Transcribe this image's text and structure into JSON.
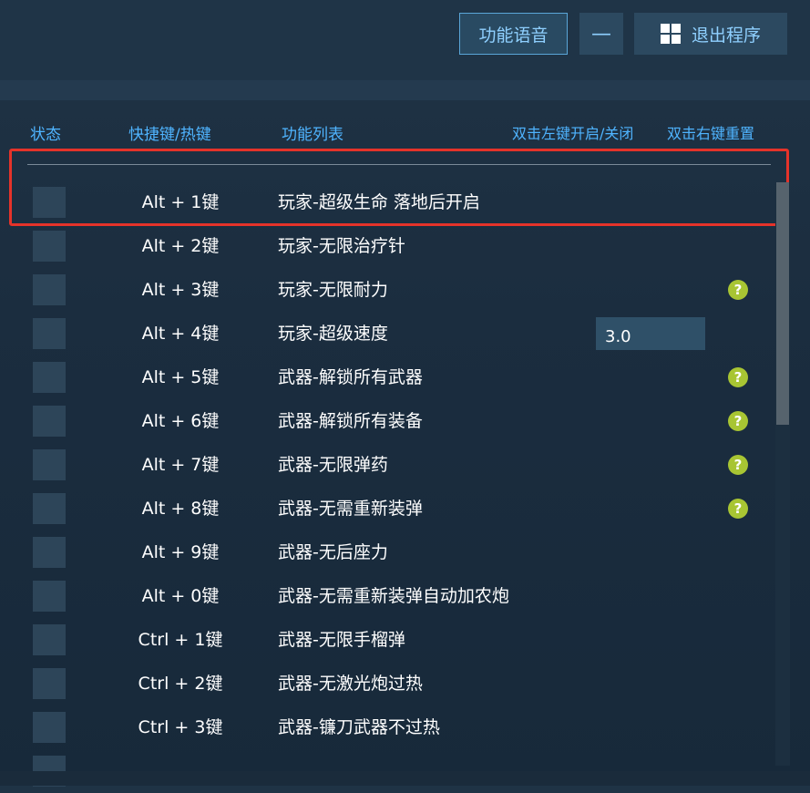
{
  "toolbar": {
    "voice_label": "功能语音",
    "minimize_label": "—",
    "exit_label": "退出程序"
  },
  "header": {
    "status": "状态",
    "hotkey": "快捷键/热键",
    "function": "功能列表",
    "double_left": "双击左键开启/关闭",
    "double_right": "双击右键重置"
  },
  "rows": [
    {
      "hotkey": "Alt + 1键",
      "function": "玩家-超级生命 落地后开启"
    },
    {
      "hotkey": "Alt + 2键",
      "function": "玩家-无限治疗针"
    },
    {
      "hotkey": "Alt + 3键",
      "function": "玩家-无限耐力",
      "help": "?"
    },
    {
      "hotkey": "Alt + 4键",
      "function": "玩家-超级速度",
      "value": "3.0"
    },
    {
      "hotkey": "Alt + 5键",
      "function": "武器-解锁所有武器",
      "help": "?"
    },
    {
      "hotkey": "Alt + 6键",
      "function": "武器-解锁所有装备",
      "help": "?"
    },
    {
      "hotkey": "Alt + 7键",
      "function": "武器-无限弹药",
      "help": "?"
    },
    {
      "hotkey": "Alt + 8键",
      "function": "武器-无需重新装弹",
      "help": "?"
    },
    {
      "hotkey": "Alt + 9键",
      "function": "武器-无后座力"
    },
    {
      "hotkey": "Alt + 0键",
      "function": "武器-无需重新装弹自动加农炮"
    },
    {
      "hotkey": "Ctrl + 1键",
      "function": "武器-无限手榴弹"
    },
    {
      "hotkey": "Ctrl + 2键",
      "function": "武器-无激光炮过热"
    },
    {
      "hotkey": "Ctrl + 3键",
      "function": "武器-镰刀武器不过热"
    }
  ],
  "colors": {
    "accent": "#4fb4ff",
    "highlight_border": "#e5332a",
    "help_icon": "#a8c533"
  }
}
